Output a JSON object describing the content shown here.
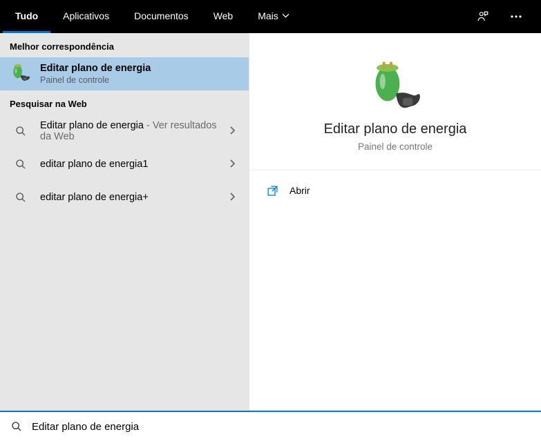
{
  "header": {
    "tabs": [
      "Tudo",
      "Aplicativos",
      "Documentos",
      "Web",
      "Mais"
    ],
    "active_tab_index": 0
  },
  "sidebar": {
    "best_match_header": "Melhor correspondência",
    "best_match": {
      "title": "Editar plano de energia",
      "subtitle": "Painel de controle"
    },
    "web_header": "Pesquisar na Web",
    "web_results": [
      {
        "title": "Editar plano de energia",
        "suffix": " - Ver resultados da Web"
      },
      {
        "title": "editar plano de energia1",
        "suffix": ""
      },
      {
        "title": "editar plano de energia+",
        "suffix": ""
      }
    ]
  },
  "detail": {
    "title": "Editar plano de energia",
    "subtitle": "Painel de controle",
    "actions": [
      {
        "label": "Abrir"
      }
    ]
  },
  "search": {
    "value": "Editar plano de energia"
  }
}
